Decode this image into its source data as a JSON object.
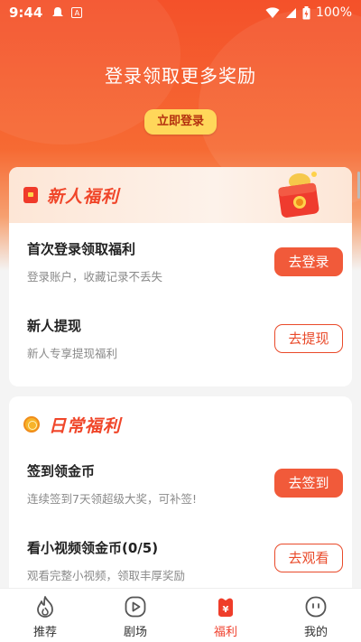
{
  "status_bar": {
    "time": "9:44",
    "battery": "100%"
  },
  "hero": {
    "title": "登录领取更多奖励",
    "login_button": "立即登录"
  },
  "newcomer": {
    "title": "新人福利",
    "items": [
      {
        "title": "首次登录领取福利",
        "subtitle": "登录账户，收藏记录不丢失",
        "button": "去登录"
      },
      {
        "title": "新人提现",
        "subtitle": "新人专享提现福利",
        "button": "去提现"
      }
    ]
  },
  "daily": {
    "title": "日常福利",
    "items": [
      {
        "title": "签到领金币",
        "subtitle": "连续签到7天领超级大奖，可补签!",
        "button": "去签到"
      },
      {
        "title": "看小视频领金币(0/5)",
        "subtitle": "观看完整小视频，领取丰厚奖励",
        "button": "去观看"
      }
    ]
  },
  "tabbar": {
    "items": [
      {
        "label": "推荐",
        "icon": "flame-icon"
      },
      {
        "label": "剧场",
        "icon": "play-icon"
      },
      {
        "label": "福利",
        "icon": "gift-icon"
      },
      {
        "label": "我的",
        "icon": "face-icon"
      }
    ],
    "active": "福利"
  },
  "colors": {
    "accent": "#f15a3a",
    "hero_top": "#f4512a",
    "login_button": "#ffd75a"
  }
}
